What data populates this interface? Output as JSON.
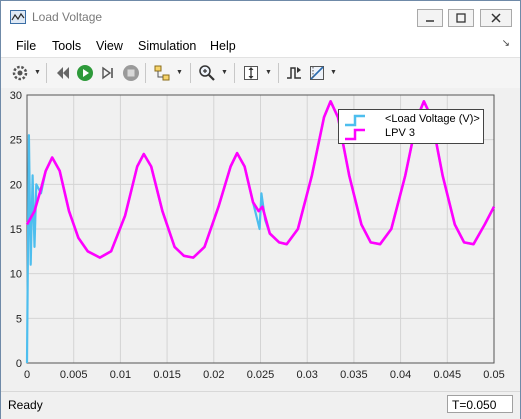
{
  "window": {
    "title": "Load Voltage"
  },
  "menu": {
    "file": "File",
    "tools": "Tools",
    "view": "View",
    "simulation": "Simulation",
    "help": "Help"
  },
  "toolbar_icons": [
    "settings-icon",
    "restore-icon",
    "run-icon",
    "step-icon",
    "stop-icon",
    "highlight-icon",
    "zoom-icon",
    "autoscale-icon",
    "triggers-icon",
    "cursor-icon"
  ],
  "status": {
    "ready": "Ready",
    "time": "T=0.050"
  },
  "colors": {
    "series1": "#4dbeee",
    "series2": "#ff00ff",
    "plot_bg": "#f0f0f0"
  },
  "chart_data": {
    "type": "line",
    "title": "",
    "xlabel": "",
    "ylabel": "",
    "xlim": [
      0,
      0.05
    ],
    "ylim": [
      0,
      30
    ],
    "grid": true,
    "legend_position": "top-right",
    "x_ticks": [
      "0",
      "0.005",
      "0.01",
      "0.015",
      "0.02",
      "0.025",
      "0.03",
      "0.035",
      "0.04",
      "0.045",
      "0.05"
    ],
    "y_ticks": [
      "0",
      "5",
      "10",
      "15",
      "20",
      "25",
      "30"
    ],
    "series": [
      {
        "name": "<Load Voltage (V)>",
        "color": "#4dbeee",
        "points": [
          [
            0,
            0
          ],
          [
            0.0002,
            25.5
          ],
          [
            0.0004,
            11
          ],
          [
            0.0006,
            21
          ],
          [
            0.0008,
            13
          ],
          [
            0.001,
            20
          ],
          [
            0.0015,
            19
          ],
          [
            0.002,
            21.5
          ],
          [
            0.0027,
            23
          ],
          [
            0.0035,
            21.5
          ],
          [
            0.0045,
            17
          ],
          [
            0.0055,
            14
          ],
          [
            0.0065,
            12.5
          ],
          [
            0.0078,
            11.8
          ],
          [
            0.009,
            12.5
          ],
          [
            0.0105,
            16.5
          ],
          [
            0.0118,
            22
          ],
          [
            0.0125,
            23.4
          ],
          [
            0.0133,
            22
          ],
          [
            0.0145,
            17
          ],
          [
            0.0158,
            13
          ],
          [
            0.0168,
            12
          ],
          [
            0.0178,
            11.8
          ],
          [
            0.019,
            13
          ],
          [
            0.0205,
            17.5
          ],
          [
            0.0218,
            22
          ],
          [
            0.0225,
            23.5
          ],
          [
            0.0233,
            22
          ],
          [
            0.0242,
            18
          ],
          [
            0.0249,
            15
          ],
          [
            0.0251,
            19
          ],
          [
            0.0255,
            16
          ],
          [
            0.026,
            14.5
          ],
          [
            0.027,
            13.5
          ],
          [
            0.0278,
            13.3
          ],
          [
            0.029,
            15
          ],
          [
            0.0305,
            21
          ],
          [
            0.0318,
            27.5
          ],
          [
            0.0325,
            29.3
          ],
          [
            0.0333,
            27.5
          ],
          [
            0.0345,
            21
          ],
          [
            0.0358,
            15.5
          ],
          [
            0.0368,
            13.5
          ],
          [
            0.0378,
            13.3
          ],
          [
            0.039,
            15
          ],
          [
            0.0405,
            21
          ],
          [
            0.0418,
            27.5
          ],
          [
            0.0425,
            29.3
          ],
          [
            0.0433,
            27.5
          ],
          [
            0.0445,
            21
          ],
          [
            0.0458,
            15.5
          ],
          [
            0.0468,
            13.5
          ],
          [
            0.0478,
            13.3
          ],
          [
            0.049,
            15.5
          ],
          [
            0.05,
            17.5
          ]
        ]
      },
      {
        "name": "LPV 3",
        "color": "#ff00ff",
        "points": [
          [
            0,
            15.5
          ],
          [
            0.0008,
            17
          ],
          [
            0.0015,
            19.5
          ],
          [
            0.002,
            21.5
          ],
          [
            0.0027,
            23
          ],
          [
            0.0035,
            21.5
          ],
          [
            0.0045,
            17
          ],
          [
            0.0055,
            14
          ],
          [
            0.0065,
            12.5
          ],
          [
            0.0078,
            11.8
          ],
          [
            0.009,
            12.5
          ],
          [
            0.0105,
            16.5
          ],
          [
            0.0118,
            22
          ],
          [
            0.0125,
            23.4
          ],
          [
            0.0133,
            22
          ],
          [
            0.0145,
            17
          ],
          [
            0.0158,
            13
          ],
          [
            0.0168,
            12
          ],
          [
            0.0178,
            11.8
          ],
          [
            0.019,
            13
          ],
          [
            0.0205,
            17.5
          ],
          [
            0.0218,
            22
          ],
          [
            0.0225,
            23.5
          ],
          [
            0.0233,
            22
          ],
          [
            0.0242,
            18
          ],
          [
            0.0248,
            17
          ],
          [
            0.0252,
            17.5
          ],
          [
            0.0256,
            16
          ],
          [
            0.026,
            14.5
          ],
          [
            0.027,
            13.5
          ],
          [
            0.0278,
            13.3
          ],
          [
            0.029,
            15
          ],
          [
            0.0305,
            21
          ],
          [
            0.0318,
            27.5
          ],
          [
            0.0325,
            29.3
          ],
          [
            0.0333,
            27.5
          ],
          [
            0.0345,
            21
          ],
          [
            0.0358,
            15.5
          ],
          [
            0.0368,
            13.5
          ],
          [
            0.0378,
            13.3
          ],
          [
            0.039,
            15
          ],
          [
            0.0405,
            21
          ],
          [
            0.0418,
            27.5
          ],
          [
            0.0425,
            29.3
          ],
          [
            0.0433,
            27.5
          ],
          [
            0.0445,
            21
          ],
          [
            0.0458,
            15.5
          ],
          [
            0.0468,
            13.5
          ],
          [
            0.0478,
            13.3
          ],
          [
            0.049,
            15.5
          ],
          [
            0.05,
            17.5
          ]
        ]
      }
    ]
  }
}
